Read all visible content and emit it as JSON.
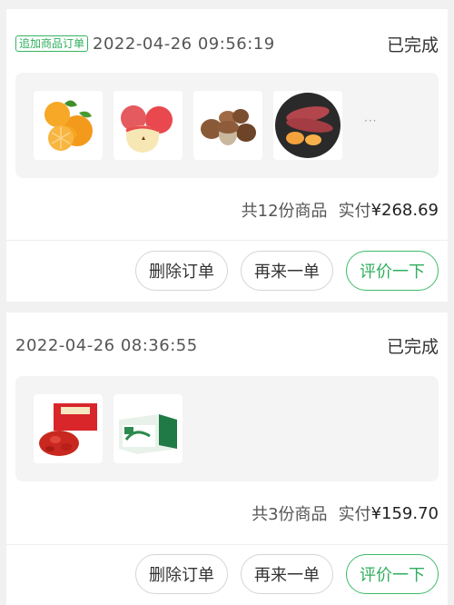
{
  "orders": [
    {
      "tag": "追加商品订单",
      "datetime": "2022-04-26 09:56:19",
      "status": "已完成",
      "products": [
        {
          "name": "orange",
          "icon": "orange-fruit-image"
        },
        {
          "name": "apple",
          "icon": "apple-fruit-image"
        },
        {
          "name": "mushroom",
          "icon": "mushroom-image"
        },
        {
          "name": "sweet-potato",
          "icon": "sweet-potato-image"
        }
      ],
      "more": "···",
      "count_text": "共12份商品",
      "paid_label": "实付",
      "paid_amount": "¥268.69",
      "buttons": {
        "delete": "删除订单",
        "reorder": "再来一单",
        "review": "评价一下"
      }
    },
    {
      "tag": "",
      "datetime": "2022-04-26 08:36:55",
      "status": "已完成",
      "products": [
        {
          "name": "crayfish",
          "icon": "crayfish-box-image"
        },
        {
          "name": "milk-box",
          "icon": "milk-gift-box-image"
        }
      ],
      "more": "",
      "count_text": "共3份商品",
      "paid_label": "实付",
      "paid_amount": "¥159.70",
      "buttons": {
        "delete": "删除订单",
        "reorder": "再来一单",
        "review": "评价一下"
      }
    }
  ],
  "colors": {
    "accent": "#2fae5c",
    "background": "#f1f1f1",
    "panel": "#f4f4f4"
  }
}
